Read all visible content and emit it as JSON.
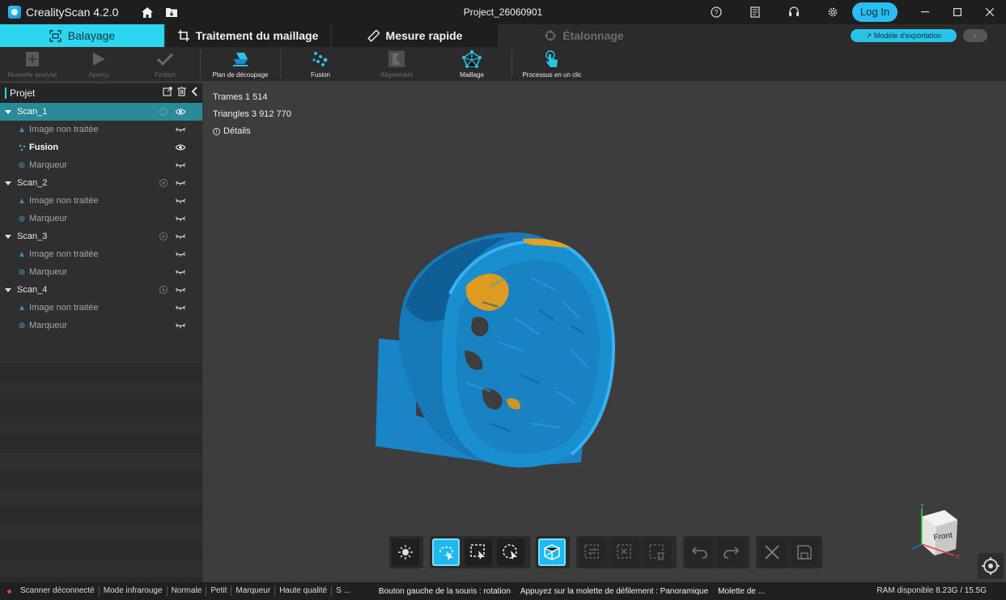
{
  "app": {
    "title": "CrealityScan 4.2.0",
    "project": "Project_26060901",
    "login_label": "Log In"
  },
  "tabs": [
    {
      "label": "Balayage",
      "icon": "scan-frame-icon"
    },
    {
      "label": "Traitement du maillage",
      "icon": "crop-icon"
    },
    {
      "label": "Mesure rapide",
      "icon": "ruler-icon"
    },
    {
      "label": "Étalonnage",
      "icon": "crosshair-icon"
    }
  ],
  "export_label": "Modèle d'exportation",
  "toolbar": [
    {
      "label": "Nouvelle analyse",
      "icon": "plus-doc-icon",
      "enabled": false
    },
    {
      "label": "Aperçu",
      "icon": "play-icon",
      "enabled": false
    },
    {
      "label": "Finition",
      "icon": "check-icon",
      "enabled": false
    },
    {
      "label": "Plan de découpage",
      "icon": "eraser-icon",
      "enabled": true
    },
    {
      "label": "Fusion",
      "icon": "fusion-dots-icon",
      "enabled": true
    },
    {
      "label": "Alignement",
      "icon": "alignment-icon",
      "enabled": false
    },
    {
      "label": "Maillage",
      "icon": "mesh-icon",
      "enabled": true
    },
    {
      "label": "Processus en un clic",
      "icon": "touch-icon",
      "enabled": true
    }
  ],
  "sidebar": {
    "title": "Projet",
    "scans": [
      {
        "name": "Scan_1",
        "items": [
          "Image non traitée",
          "Fusion",
          "Marqueur"
        ]
      },
      {
        "name": "Scan_2",
        "items": [
          "Image non traitée",
          "Marqueur"
        ]
      },
      {
        "name": "Scan_3",
        "items": [
          "Image non traitée",
          "Marqueur"
        ]
      },
      {
        "name": "Scan_4",
        "items": [
          "Image non traitée",
          "Marqueur"
        ]
      }
    ]
  },
  "viewport": {
    "frames": "Trames 1 514",
    "triangles": "Triangles 3 912 770",
    "details": "Détails",
    "gizmo_face": "Front",
    "axis_x": "X",
    "axis_y": "Y"
  },
  "status": {
    "items": [
      "Scanner déconnecté",
      "Mode infrarouge",
      "Normale",
      "Petit",
      "Marqueur",
      "Haute qualité",
      "S ..."
    ],
    "hint_left": "Bouton gauche de la souris : rotation",
    "hint_wheel": "Appuyez sur la molette de défilement : Panoramique",
    "hint_more": "Molette de ...",
    "ram": "RAM disponible 8.23G / 15.5G"
  },
  "colors": {
    "accent": "#2bd6f0",
    "model_blue": "#1a8fd0",
    "model_orange": "#e0a020"
  }
}
